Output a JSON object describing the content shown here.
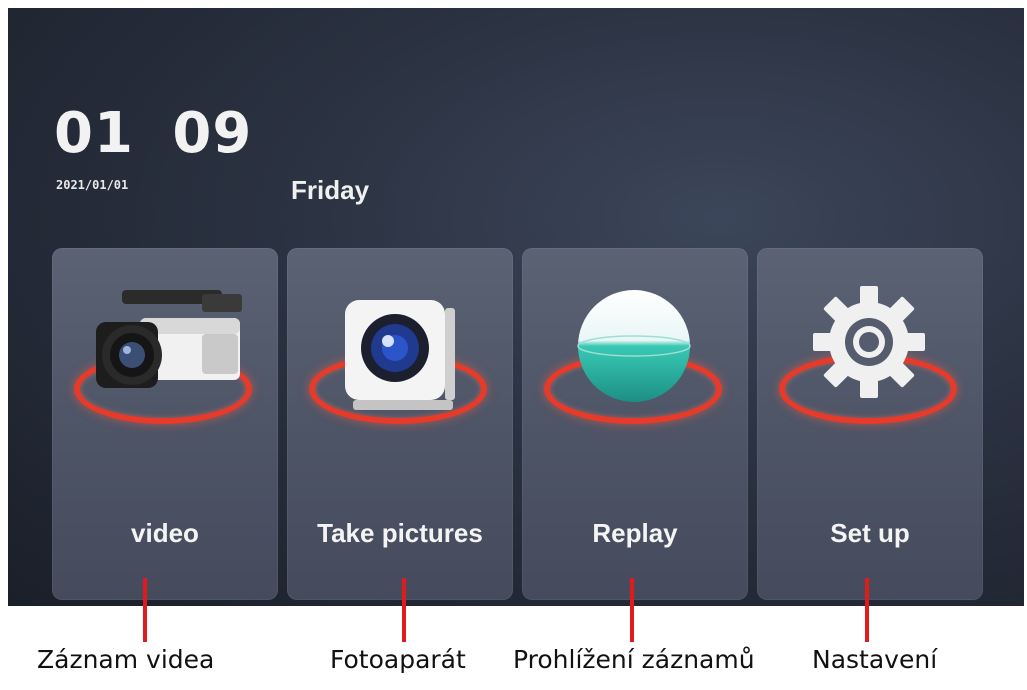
{
  "clock": {
    "time": "01 09",
    "date": "2021/01/01",
    "weekday": "Friday"
  },
  "tiles": [
    {
      "label": "video",
      "icon": "video-camera-icon"
    },
    {
      "label": "Take pictures",
      "icon": "camera-icon"
    },
    {
      "label": "Replay",
      "icon": "replay-sphere-icon"
    },
    {
      "label": "Set up",
      "icon": "gear-icon"
    }
  ],
  "captions": [
    "Záznam videa",
    "Fotoaparát",
    "Prohlížení záznamů",
    "Nastavení"
  ],
  "colors": {
    "accent_ring": "#e63a2a",
    "callout": "#e01b1b",
    "tile_bg": "#545b6d",
    "screen_bg": "#2a3140"
  }
}
